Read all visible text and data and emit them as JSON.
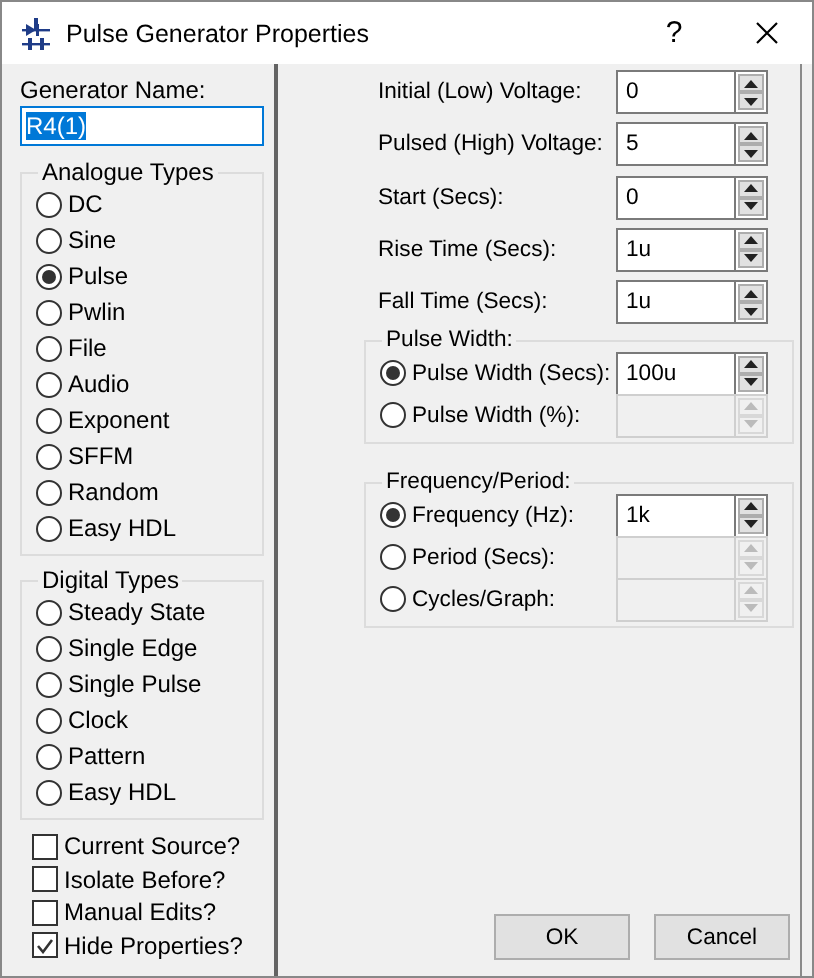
{
  "window": {
    "title": "Pulse Generator Properties",
    "help": "?"
  },
  "generator_name": {
    "label": "Generator Name:",
    "value": "R4(1)",
    "text_selected": true
  },
  "analogue_types": {
    "title": "Analogue Types",
    "options": [
      {
        "label": "DC",
        "selected": false
      },
      {
        "label": "Sine",
        "selected": false
      },
      {
        "label": "Pulse",
        "selected": true
      },
      {
        "label": "Pwlin",
        "selected": false
      },
      {
        "label": "File",
        "selected": false
      },
      {
        "label": "Audio",
        "selected": false
      },
      {
        "label": "Exponent",
        "selected": false
      },
      {
        "label": "SFFM",
        "selected": false
      },
      {
        "label": "Random",
        "selected": false
      },
      {
        "label": "Easy HDL",
        "selected": false
      }
    ]
  },
  "digital_types": {
    "title": "Digital Types",
    "options": [
      {
        "label": "Steady State",
        "selected": false
      },
      {
        "label": "Single Edge",
        "selected": false
      },
      {
        "label": "Single Pulse",
        "selected": false
      },
      {
        "label": "Clock",
        "selected": false
      },
      {
        "label": "Pattern",
        "selected": false
      },
      {
        "label": "Easy HDL",
        "selected": false
      }
    ]
  },
  "checkboxes": [
    {
      "label": "Current Source?",
      "checked": false
    },
    {
      "label": "Isolate Before?",
      "checked": false
    },
    {
      "label": "Manual Edits?",
      "checked": false
    },
    {
      "label": "Hide Properties?",
      "checked": true
    }
  ],
  "parameters": [
    {
      "label": "Initial (Low) Voltage:",
      "value": "0"
    },
    {
      "label": "Pulsed (High) Voltage:",
      "value": "5"
    },
    {
      "label": "Start (Secs):",
      "value": "0"
    },
    {
      "label": "Rise Time (Secs):",
      "value": "1u"
    },
    {
      "label": "Fall Time (Secs):",
      "value": "1u"
    }
  ],
  "pulse_width": {
    "title": "Pulse Width:",
    "options": [
      {
        "label": "Pulse Width (Secs):",
        "selected": true,
        "value": "100u",
        "disabled": false
      },
      {
        "label": "Pulse Width (%):",
        "selected": false,
        "disabled": true
      }
    ]
  },
  "frequency_period": {
    "title": "Frequency/Period:",
    "options": [
      {
        "label": "Frequency (Hz):",
        "selected": true,
        "value": "1k",
        "disabled": false
      },
      {
        "label": "Period (Secs):",
        "selected": false,
        "disabled": true
      },
      {
        "label": "Cycles/Graph:",
        "selected": false,
        "disabled": true
      }
    ]
  },
  "buttons": [
    {
      "label": "OK"
    },
    {
      "label": "Cancel"
    }
  ]
}
